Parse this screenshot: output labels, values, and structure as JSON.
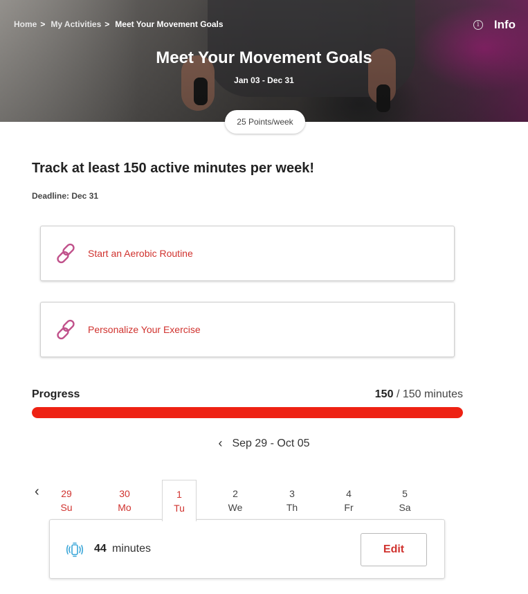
{
  "hero": {
    "breadcrumb": [
      {
        "label": "Home"
      },
      {
        "label": "My Activities"
      },
      {
        "label": "Meet Your Movement Goals"
      }
    ],
    "breadcrumb_separator": ">",
    "info_label": "Info",
    "title": "Meet Your Movement Goals",
    "dates": "Jan 03 - Dec 31",
    "points": "25 Points/week"
  },
  "main": {
    "heading": "Track at least 150 active minutes per week!",
    "deadline": "Deadline: Dec 31",
    "links": [
      {
        "label": "Start an Aerobic Routine",
        "icon": "link-icon"
      },
      {
        "label": "Personalize Your Exercise",
        "icon": "link-icon"
      }
    ]
  },
  "progress": {
    "label": "Progress",
    "current": "150",
    "goal_text": "/ 150 minutes",
    "fraction": 1.0,
    "color": "#ee2213"
  },
  "week": {
    "range": "Sep 29 - Oct 05",
    "days": [
      {
        "num": "29",
        "dow": "Su",
        "state": "red"
      },
      {
        "num": "30",
        "dow": "Mo",
        "state": "red"
      },
      {
        "num": "1",
        "dow": "Tu",
        "state": "selected"
      },
      {
        "num": "2",
        "dow": "We",
        "state": "grey"
      },
      {
        "num": "3",
        "dow": "Th",
        "state": "grey"
      },
      {
        "num": "4",
        "dow": "Fr",
        "state": "grey"
      },
      {
        "num": "5",
        "dow": "Sa",
        "state": "grey"
      }
    ]
  },
  "activity": {
    "icon": "watch-icon",
    "minutes": "44",
    "unit": "minutes",
    "edit_label": "Edit"
  },
  "colors": {
    "accent_red": "#d0322e",
    "link_icon_pink": "#c0508a",
    "watch_icon_blue": "#3aa6d8"
  }
}
